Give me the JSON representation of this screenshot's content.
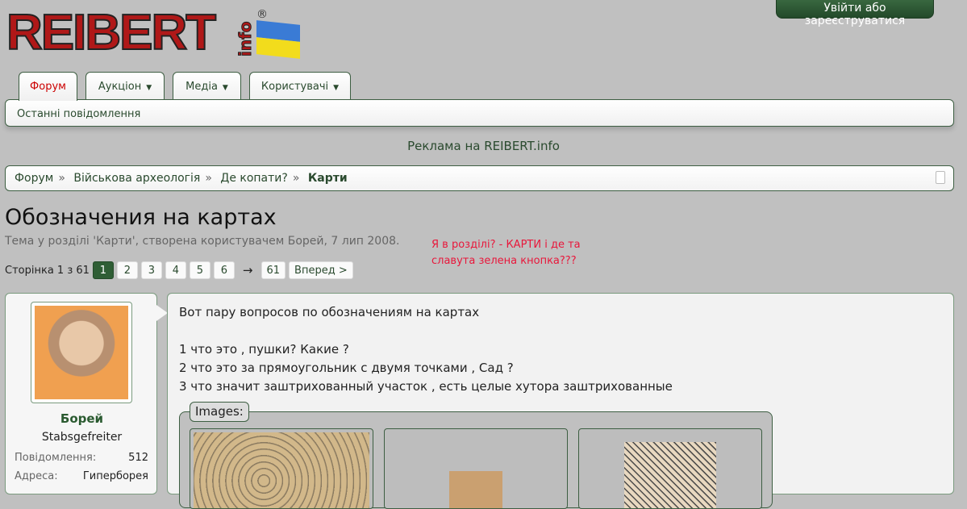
{
  "logo": {
    "text": "REIBERT",
    "suffix": "info",
    "reg": "®"
  },
  "header": {
    "login_label": "Увійти або зареєструватися"
  },
  "tabs": [
    {
      "label": "Форум"
    },
    {
      "label": "Аукціон"
    },
    {
      "label": "Медіа"
    },
    {
      "label": "Користувачі"
    }
  ],
  "subnav": {
    "item": "Останні повідомлення"
  },
  "ad": "Реклама на REIBERT.info",
  "breadcrumb": [
    "Форум",
    "Військова археологія",
    "Де копати?",
    "Карти"
  ],
  "thread": {
    "title": "Обозначения на картах",
    "meta": "Тема у розділі 'Карти', створена користувачем Борей, 7 лип 2008."
  },
  "annotation": {
    "line1": "Я в розділі? - КАРТИ і де та",
    "line2": "славута зелена кнопка???"
  },
  "pager": {
    "label": "Сторінка 1 з 61",
    "pages": [
      "1",
      "2",
      "3",
      "4",
      "5",
      "6"
    ],
    "arrow": "→",
    "last": "61",
    "next": "Вперед >"
  },
  "user": {
    "name": "Борей",
    "rank": "Stabsgefreiter",
    "stats": [
      {
        "k": "Повідомлення:",
        "v": "512"
      },
      {
        "k": "Адреса:",
        "v": "Гиперборея"
      }
    ]
  },
  "post": {
    "lines": [
      "Вот пару вопросов по обозначениям на картах",
      "1 что это , пушки? Какие ?",
      "2 что это за прямоугольник с двумя точками , Сад ?",
      "3 что значит заштрихованный участок , есть целые хутора заштрихованные"
    ],
    "images_label": "Images:"
  },
  "colors": {
    "accent": "#2f5e35",
    "note": "#e8173b"
  }
}
